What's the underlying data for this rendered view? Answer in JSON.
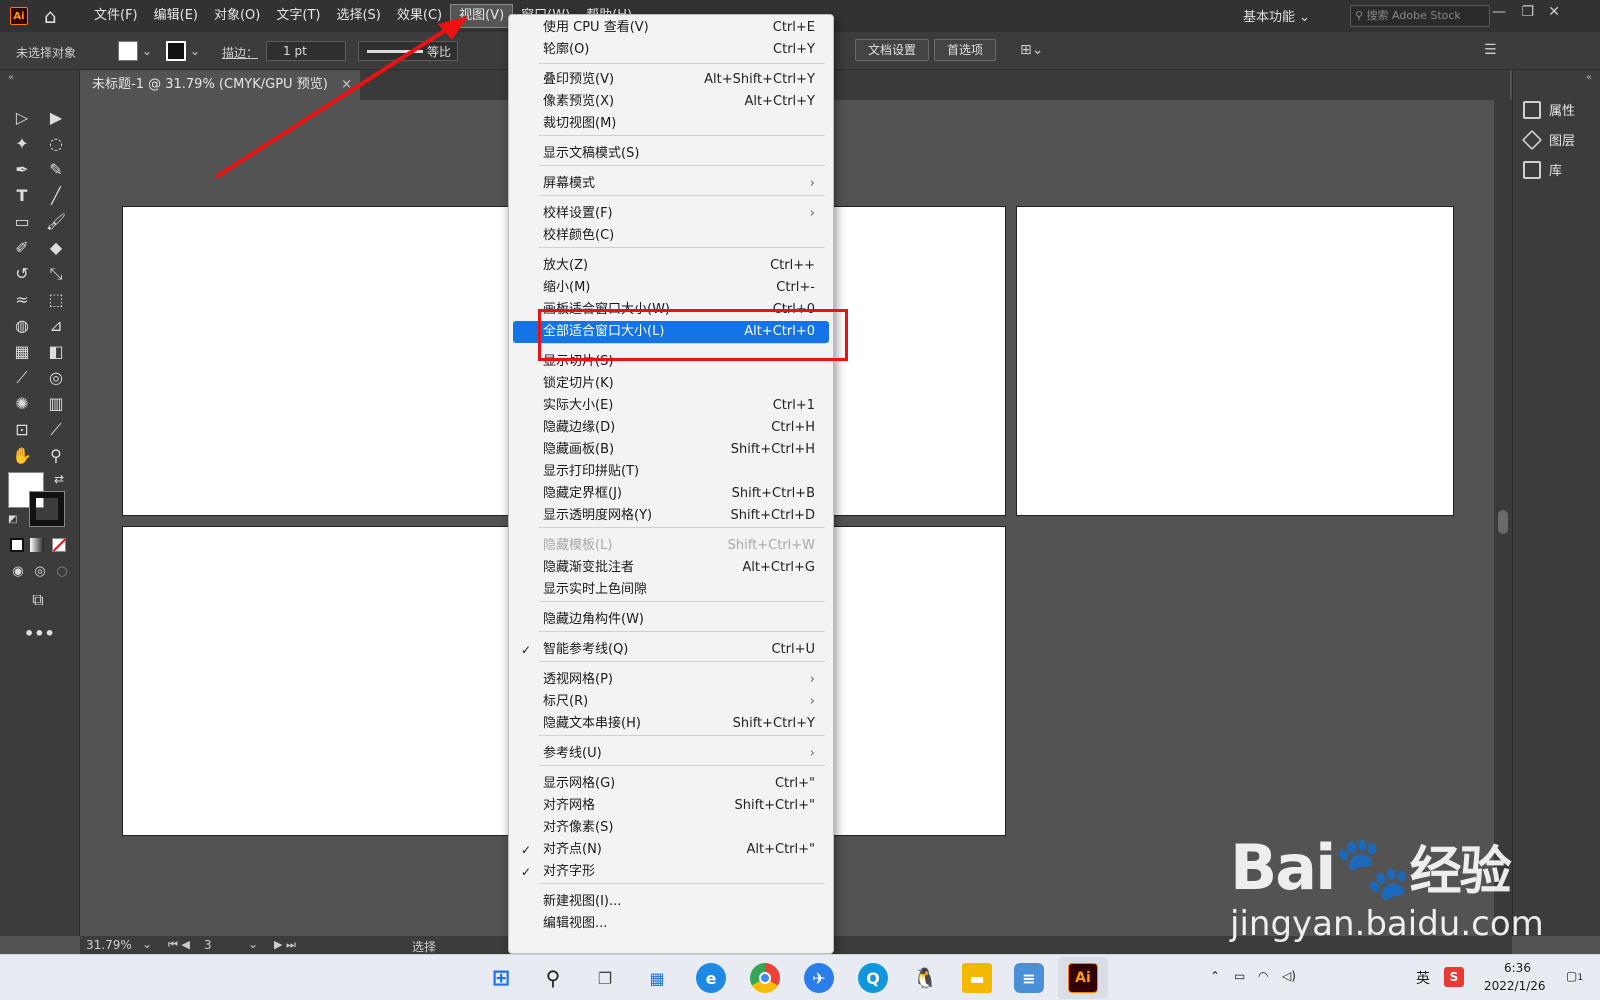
{
  "app": {
    "logo_text": "Ai",
    "menus": [
      "文件(F)",
      "编辑(E)",
      "对象(O)",
      "文字(T)",
      "选择(S)",
      "效果(C)",
      "视图(V)",
      "窗口(W)",
      "帮助(H)"
    ],
    "active_menu": "视图(V)",
    "workspace": "基本功能",
    "search_placeholder": "搜索 Adobe Stock"
  },
  "control_bar": {
    "no_selection": "未选择对象",
    "stroke_label": "描边：",
    "stroke_value": "1 pt",
    "stroke_style": "等比",
    "doc_settings": "文档设置",
    "preferences": "首选项"
  },
  "document_tab": {
    "title": "未标题-1 @ 31.79% (CMYK/GPU 预览)",
    "close": "×"
  },
  "right_panel": {
    "items": [
      {
        "label": "属性",
        "icon": "properties-icon"
      },
      {
        "label": "图层",
        "icon": "layers-icon"
      },
      {
        "label": "库",
        "icon": "libraries-icon"
      }
    ]
  },
  "status_bar": {
    "zoom": "31.79%",
    "artboard_index": "3",
    "tool": "选择"
  },
  "view_menu": {
    "items": [
      {
        "label": "使用 CPU 查看(V)",
        "shortcut": "Ctrl+E"
      },
      {
        "label": "轮廓(O)",
        "shortcut": "Ctrl+Y"
      },
      {
        "label": "叠印预览(V)",
        "shortcut": "Alt+Shift+Ctrl+Y"
      },
      {
        "label": "像素预览(X)",
        "shortcut": "Alt+Ctrl+Y"
      },
      {
        "label": "裁切视图(M)",
        "shortcut": ""
      },
      {
        "label": "显示文稿模式(S)",
        "shortcut": ""
      },
      {
        "label": "屏幕模式",
        "shortcut": ""
      },
      {
        "label": "校样设置(F)",
        "shortcut": ""
      },
      {
        "label": "校样颜色(C)",
        "shortcut": ""
      },
      {
        "label": "放大(Z)",
        "shortcut": "Ctrl++"
      },
      {
        "label": "缩小(M)",
        "shortcut": "Ctrl+-"
      },
      {
        "label": "画板适合窗口大小(W)",
        "shortcut": "Ctrl+0"
      },
      {
        "label": "全部适合窗口大小(L)",
        "shortcut": "Alt+Ctrl+0"
      },
      {
        "label": "显示切片(S)",
        "shortcut": ""
      },
      {
        "label": "锁定切片(K)",
        "shortcut": ""
      },
      {
        "label": "实际大小(E)",
        "shortcut": "Ctrl+1"
      },
      {
        "label": "隐藏边缘(D)",
        "shortcut": "Ctrl+H"
      },
      {
        "label": "隐藏画板(B)",
        "shortcut": "Shift+Ctrl+H"
      },
      {
        "label": "显示打印拼贴(T)",
        "shortcut": ""
      },
      {
        "label": "隐藏定界框(J)",
        "shortcut": "Shift+Ctrl+B"
      },
      {
        "label": "显示透明度网格(Y)",
        "shortcut": "Shift+Ctrl+D"
      },
      {
        "label": "隐藏模板(L)",
        "shortcut": "Shift+Ctrl+W"
      },
      {
        "label": "隐藏渐变批注者",
        "shortcut": "Alt+Ctrl+G"
      },
      {
        "label": "显示实时上色间隙",
        "shortcut": ""
      },
      {
        "label": "隐藏边角构件(W)",
        "shortcut": ""
      },
      {
        "label": "智能参考线(Q)",
        "shortcut": "Ctrl+U"
      },
      {
        "label": "透视网格(P)",
        "shortcut": ""
      },
      {
        "label": "标尺(R)",
        "shortcut": ""
      },
      {
        "label": "隐藏文本串接(H)",
        "shortcut": "Shift+Ctrl+Y"
      },
      {
        "label": "参考线(U)",
        "shortcut": ""
      },
      {
        "label": "显示网格(G)",
        "shortcut": "Ctrl+\""
      },
      {
        "label": "对齐网格",
        "shortcut": "Shift+Ctrl+\""
      },
      {
        "label": "对齐像素(S)",
        "shortcut": ""
      },
      {
        "label": "对齐点(N)",
        "shortcut": "Alt+Ctrl+\""
      },
      {
        "label": "对齐字形",
        "shortcut": ""
      },
      {
        "label": "新建视图(I)...",
        "shortcut": ""
      },
      {
        "label": "编辑视图...",
        "shortcut": ""
      }
    ],
    "highlighted_index": 12,
    "disabled_index": 21,
    "checked_indices": [
      25,
      33,
      34
    ],
    "submenu_indices": [
      6,
      7,
      26,
      27,
      29
    ]
  },
  "taskbar": {
    "ime": "英",
    "time": "6:36",
    "date": "2022/1/26",
    "notification_count": "1"
  },
  "watermark": {
    "brand": "Bai",
    "brand_suffix": "经验",
    "url": "jingyan.baidu.com"
  },
  "colors": {
    "accent": "#1473e6",
    "annotation": "#e11111"
  }
}
